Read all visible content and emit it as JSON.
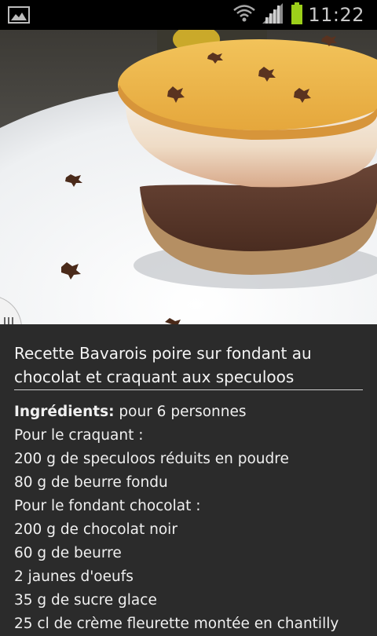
{
  "status_bar": {
    "time": "11:22",
    "icons": [
      "gallery-notification-icon",
      "wifi-icon",
      "signal-icon",
      "battery-icon"
    ],
    "battery_color": "#9ccf1a"
  },
  "recipe": {
    "title": "Recette Bavarois poire sur fondant au chocolat et craquant aux speculoos",
    "ingredients_label": "Ingrédients:",
    "servings": " pour 6 personnes",
    "lines": [
      "Pour le craquant :",
      "200 g de speculoos réduits en poudre",
      "80 g de beurre fondu",
      "Pour le fondant chocolat :",
      "200 g de chocolat noir",
      "60 g de beurre",
      "2 jaunes d'oeufs",
      "35 g de sucre glace",
      "25 cl de crème fleurette montée en chantilly"
    ]
  },
  "colors": {
    "background": "#2b2b2b",
    "text": "#f1f1f1",
    "status_bar": "#000000"
  }
}
